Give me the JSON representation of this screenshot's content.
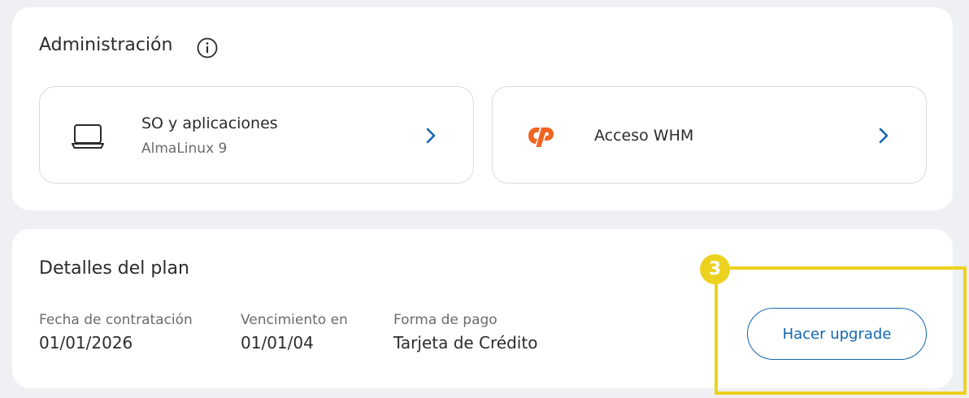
{
  "administracion": {
    "title": "Administración",
    "info_icon": "info-circle-icon",
    "tiles": [
      {
        "title": "SO y aplicaciones",
        "subtitle": "AlmaLinux 9",
        "icon": "laptop-icon",
        "chevron": "chevron-right-icon"
      },
      {
        "title": "Acceso WHM",
        "icon": "cpanel-logo-icon",
        "chevron": "chevron-right-icon"
      }
    ]
  },
  "plan": {
    "title": "Detalles del plan",
    "details": [
      {
        "label": "Fecha de contratación",
        "value": "01/01/2026"
      },
      {
        "label": "Vencimiento en",
        "value": "01/01/04"
      },
      {
        "label": "Forma de pago",
        "value": "Tarjeta de Crédito"
      }
    ],
    "upgrade_label": "Hacer upgrade"
  },
  "annotation": {
    "step_number": "3",
    "highlight_color": "#ecd21f"
  },
  "colors": {
    "background": "#eff0f3",
    "card": "#ffffff",
    "accent_blue": "#1466b0",
    "cpanel_orange": "#f06422"
  }
}
